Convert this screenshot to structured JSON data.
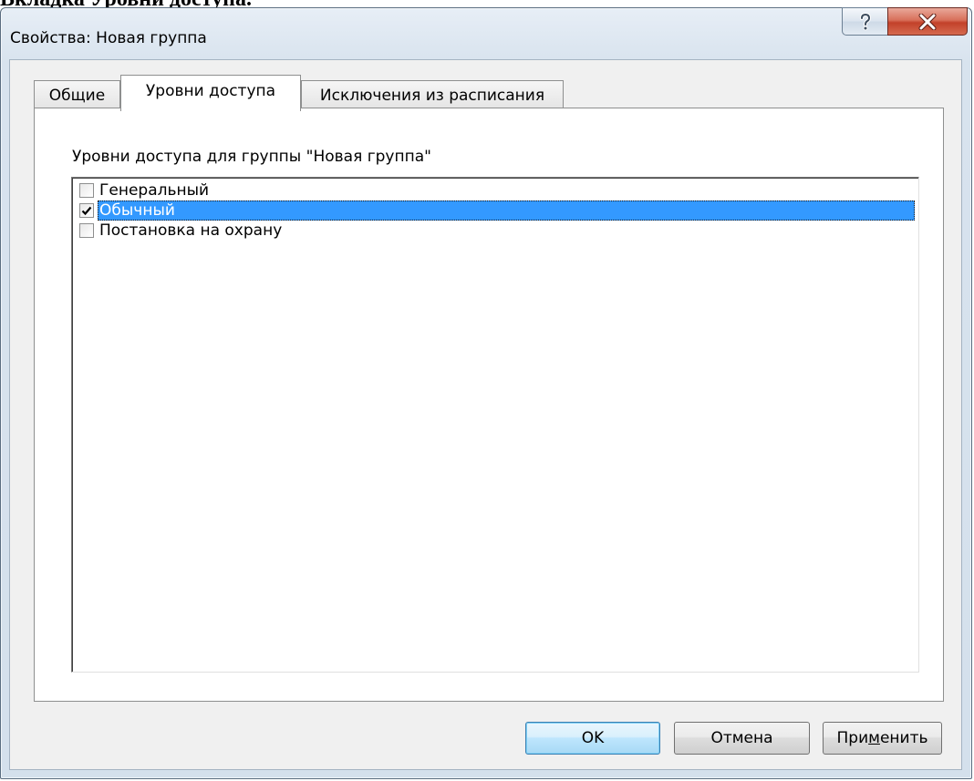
{
  "doc_heading": "Вкладка Уровни доступа.",
  "window": {
    "title": "Свойства: Новая группа",
    "help_label": "?",
    "close_label": "X"
  },
  "tabs": [
    {
      "label": "Общие",
      "active": false
    },
    {
      "label": "Уровни доступа",
      "active": true
    },
    {
      "label": "Исключения из расписания",
      "active": false
    }
  ],
  "panel": {
    "group_label": "Уровни доступа для группы \"Новая группа\"",
    "items": [
      {
        "label": "Генеральный",
        "checked": false,
        "selected": false
      },
      {
        "label": "Обычный",
        "checked": true,
        "selected": true
      },
      {
        "label": "Постановка на охрану",
        "checked": false,
        "selected": false
      }
    ]
  },
  "buttons": {
    "ok": "OK",
    "cancel": "Отмена",
    "apply_before": "При",
    "apply_accel": "м",
    "apply_after": "енить"
  },
  "colors": {
    "selection": "#3399ff",
    "close_button": "#c2412a"
  }
}
